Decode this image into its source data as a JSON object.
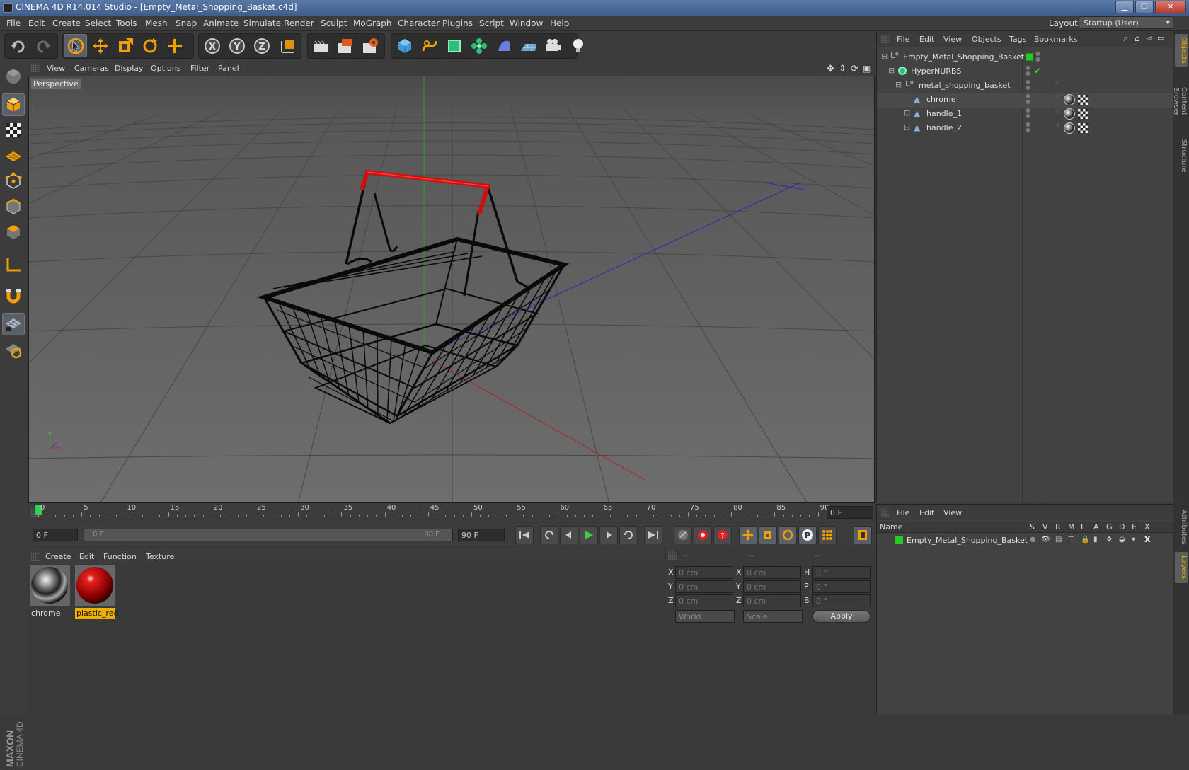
{
  "window": {
    "title": "CINEMA 4D R14.014 Studio - [Empty_Metal_Shopping_Basket.c4d]",
    "minimize": "▁",
    "restore": "❐",
    "close": "✕"
  },
  "menubar": {
    "items": [
      "File",
      "Edit",
      "Create",
      "Select",
      "Tools",
      "Mesh",
      "Snap",
      "Animate",
      "Simulate",
      "Render",
      "Sculpt",
      "MoGraph",
      "Character",
      "Plugins",
      "Script",
      "Window",
      "Help"
    ],
    "layout_label": "Layout:",
    "layout_value": "Startup (User)"
  },
  "toolbar": {
    "icons": [
      "undo-icon",
      "redo-icon",
      "select-icon",
      "move-icon",
      "scale-icon",
      "rotate-icon",
      "add-icon",
      "x-axis-icon",
      "y-axis-icon",
      "z-axis-icon",
      "coordinate-system-icon",
      "render-view-icon",
      "render-picture-viewer-icon",
      "edit-render-settings-icon",
      "cube-icon",
      "spline-icon",
      "nurbs-icon",
      "array-icon",
      "deformer-icon",
      "scene-floor-icon",
      "camera-icon",
      "light-icon"
    ],
    "axis_x": "X",
    "axis_y": "Y",
    "axis_z": "Z"
  },
  "lefttools": {
    "icons": [
      "make-editable-icon",
      "model-mode-icon",
      "texture-mode-icon",
      "workplane-icon",
      "points-mode-icon",
      "edges-mode-icon",
      "polygons-mode-icon",
      "axis-mode-icon",
      "magnet-icon",
      "locked-workplane-icon",
      "snap-icon"
    ]
  },
  "brand": {
    "maxon": "MAXON",
    "product": "CINEMA 4D"
  },
  "viewport": {
    "menu": [
      "View",
      "Cameras",
      "Display",
      "Options",
      "Filter",
      "Panel"
    ],
    "label": "Perspective",
    "axis_x": "x",
    "axis_y": "y",
    "axis_z": "z"
  },
  "timeline": {
    "ticks": [
      "0",
      "5",
      "10",
      "15",
      "20",
      "25",
      "30",
      "35",
      "40",
      "45",
      "50",
      "55",
      "60",
      "65",
      "70",
      "75",
      "80",
      "85",
      "90"
    ],
    "current_frame": "0 F"
  },
  "transport": {
    "start_field": "0 F",
    "range_start": "0 F",
    "range_end": "90 F",
    "end_field": "90 F"
  },
  "material_manager": {
    "menu": [
      "Create",
      "Edit",
      "Function",
      "Texture"
    ],
    "materials": [
      {
        "name": "chrome",
        "selected": false
      },
      {
        "name": "plastic_red",
        "selected": true
      }
    ]
  },
  "coordinates": {
    "headers": [
      "--",
      "--",
      "--"
    ],
    "rows": [
      {
        "a": "X",
        "av": "0 cm",
        "b": "X",
        "bv": "0 cm",
        "c": "H",
        "cv": "0 °"
      },
      {
        "a": "Y",
        "av": "0 cm",
        "b": "Y",
        "bv": "0 cm",
        "c": "P",
        "cv": "0 °"
      },
      {
        "a": "Z",
        "av": "0 cm",
        "b": "Z",
        "bv": "0 cm",
        "c": "B",
        "cv": "0 °"
      }
    ],
    "space": "World",
    "mode": "Scale",
    "apply": "Apply"
  },
  "object_manager": {
    "menu": [
      "File",
      "Edit",
      "View",
      "Objects",
      "Tags",
      "Bookmarks"
    ],
    "objects": [
      {
        "name": "Empty_Metal_Shopping_Basket",
        "indent": 0,
        "type": "null"
      },
      {
        "name": "HyperNURBS",
        "indent": 1,
        "type": "nurbs"
      },
      {
        "name": "metal_shopping_basket",
        "indent": 2,
        "type": "null"
      },
      {
        "name": "chrome",
        "indent": 3,
        "type": "poly"
      },
      {
        "name": "handle_1",
        "indent": 3,
        "type": "poly"
      },
      {
        "name": "handle_2",
        "indent": 3,
        "type": "poly"
      }
    ]
  },
  "layer_manager": {
    "menu": [
      "File",
      "Edit",
      "View"
    ],
    "col_name": "Name",
    "cols": [
      "S",
      "V",
      "R",
      "M",
      "L",
      "A",
      "G",
      "D",
      "E",
      "X"
    ],
    "layers": [
      {
        "name": "Empty_Metal_Shopping_Basket",
        "color": "#22cc22"
      }
    ]
  },
  "side_tabs": {
    "top": [
      "Objects",
      "Content Browser",
      "Structure"
    ],
    "bottom": [
      "Attributes",
      "Layers"
    ]
  },
  "colors": {
    "accent": "#f0a000",
    "selection": "#f0b000",
    "layer_green": "#22cc22",
    "basket_handle": "#d01010"
  }
}
